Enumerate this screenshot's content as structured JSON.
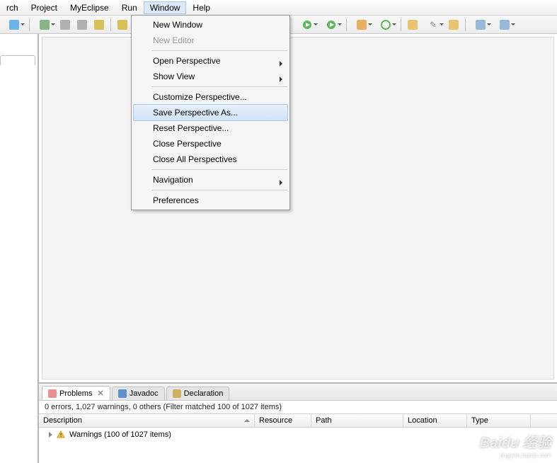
{
  "menubar": [
    "rch",
    "Project",
    "MyEclipse",
    "Run",
    "Window",
    "Help"
  ],
  "active_menu_index": 4,
  "window_menu": {
    "groups": [
      [
        {
          "label": "New Window",
          "disabled": false,
          "submenu": false
        },
        {
          "label": "New Editor",
          "disabled": true,
          "submenu": false
        }
      ],
      [
        {
          "label": "Open Perspective",
          "disabled": false,
          "submenu": true
        },
        {
          "label": "Show View",
          "disabled": false,
          "submenu": true
        }
      ],
      [
        {
          "label": "Customize Perspective...",
          "disabled": false,
          "submenu": false
        },
        {
          "label": "Save Perspective As...",
          "disabled": false,
          "submenu": false,
          "hover": true
        },
        {
          "label": "Reset Perspective...",
          "disabled": false,
          "submenu": false
        },
        {
          "label": "Close Perspective",
          "disabled": false,
          "submenu": false
        },
        {
          "label": "Close All Perspectives",
          "disabled": false,
          "submenu": false
        }
      ],
      [
        {
          "label": "Navigation",
          "disabled": false,
          "submenu": true
        }
      ],
      [
        {
          "label": "Preferences",
          "disabled": false,
          "submenu": false
        }
      ]
    ]
  },
  "bottom_tabs": [
    {
      "label": "Problems",
      "active": true,
      "icon": "problems"
    },
    {
      "label": "Javadoc",
      "active": false,
      "icon": "javadoc"
    },
    {
      "label": "Declaration",
      "active": false,
      "icon": "declaration"
    }
  ],
  "status_line": "0 errors, 1,027 warnings, 0 others (Filter matched 100 of 1027 items)",
  "table_headers": [
    "Description",
    "Resource",
    "Path",
    "Location",
    "Type"
  ],
  "table_col_widths": [
    305,
    80,
    130,
    90,
    90
  ],
  "warning_row": "Warnings (100 of 1027 items)",
  "watermark": {
    "brand": "Baidu 经验",
    "url": "jingyan.baidu.com"
  }
}
